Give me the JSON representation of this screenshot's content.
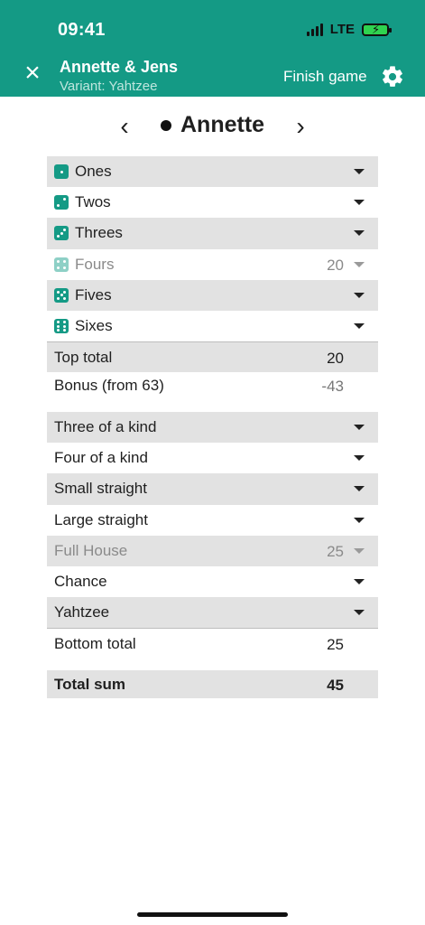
{
  "status": {
    "time": "09:41",
    "network": "LTE"
  },
  "header": {
    "title": "Annette & Jens",
    "subtitle": "Variant: Yahtzee",
    "finish_label": "Finish game",
    "close_icon": "close-icon",
    "settings_icon": "gear-icon",
    "color": "#149a85"
  },
  "player": {
    "name": "Annette",
    "prev_icon": "chevron-left-icon",
    "next_icon": "chevron-right-icon"
  },
  "upper": {
    "rows": [
      {
        "label": "Ones",
        "value": "",
        "die": 1,
        "disabled": false
      },
      {
        "label": "Twos",
        "value": "",
        "die": 2,
        "disabled": false
      },
      {
        "label": "Threes",
        "value": "",
        "die": 3,
        "disabled": false
      },
      {
        "label": "Fours",
        "value": "20",
        "die": 4,
        "disabled": true
      },
      {
        "label": "Fives",
        "value": "",
        "die": 5,
        "disabled": false
      },
      {
        "label": "Sixes",
        "value": "",
        "die": 6,
        "disabled": false
      }
    ],
    "top_total_label": "Top total",
    "top_total_value": "20",
    "bonus_label": "Bonus (from 63)",
    "bonus_value": "-43"
  },
  "lower": {
    "rows": [
      {
        "label": "Three of a kind",
        "value": "",
        "disabled": false
      },
      {
        "label": "Four of a kind",
        "value": "",
        "disabled": false
      },
      {
        "label": "Small straight",
        "value": "",
        "disabled": false
      },
      {
        "label": "Large straight",
        "value": "",
        "disabled": false
      },
      {
        "label": "Full House",
        "value": "25",
        "disabled": true
      },
      {
        "label": "Chance",
        "value": "",
        "disabled": false
      },
      {
        "label": "Yahtzee",
        "value": "",
        "disabled": false
      }
    ],
    "bottom_total_label": "Bottom total",
    "bottom_total_value": "25"
  },
  "total": {
    "label": "Total sum",
    "value": "45"
  }
}
